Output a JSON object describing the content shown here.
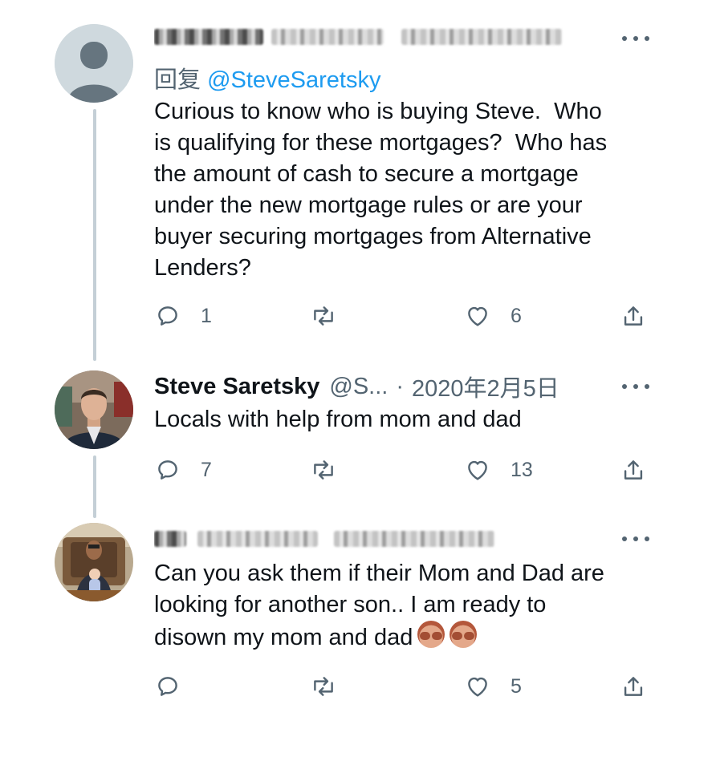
{
  "colors": {
    "text": "#0f1419",
    "muted": "#536471",
    "link": "#1d9bf0",
    "thread": "#c4cfd6"
  },
  "tweets": [
    {
      "author": {
        "name_redacted": true,
        "avatar": "default-avatar"
      },
      "reply_prefix": "回复 ",
      "reply_to": "@SteveSaretsky",
      "text": "Curious to know who is buying Steve.  Who\nis qualifying for these mortgages?  Who has\nthe amount of cash to secure a mortgage\nunder the new mortgage rules or are your\nbuyer securing mortgages from Alternative\nLenders?",
      "actions": {
        "reply_count": "1",
        "retweet_count": "",
        "like_count": "6"
      }
    },
    {
      "author": {
        "name": "Steve Saretsky",
        "handle": "@S...",
        "separator": "·",
        "date": "2020年2月5日",
        "avatar": "man-suit-photo"
      },
      "text": "Locals with help from mom and dad",
      "actions": {
        "reply_count": "7",
        "retweet_count": "",
        "like_count": "13"
      }
    },
    {
      "author": {
        "name_redacted": true,
        "avatar": "man-with-baby-photo"
      },
      "text": "Can you ask them if their Mom and Dad are\nlooking for another son.. I am ready to\ndisown my mom and dad",
      "emoji": [
        "see-no-evil-monkey",
        "see-no-evil-monkey"
      ],
      "actions": {
        "reply_count": "",
        "retweet_count": "",
        "like_count": "5"
      }
    }
  ]
}
